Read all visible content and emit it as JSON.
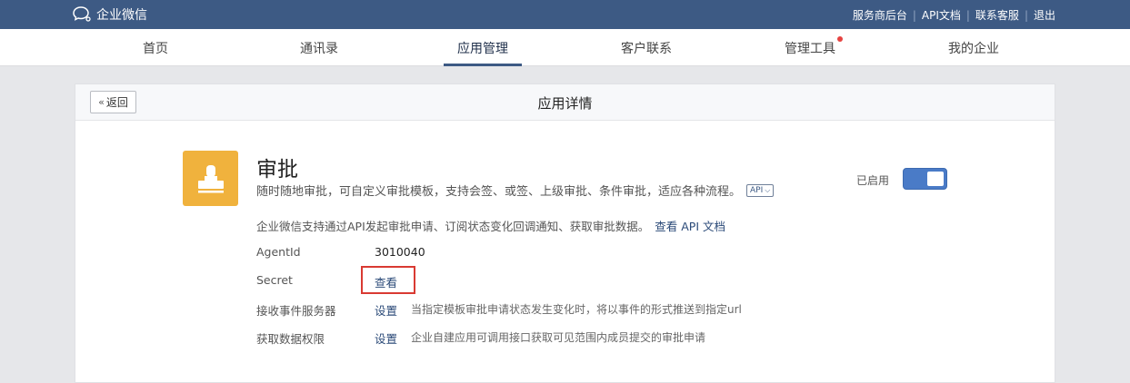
{
  "topbar": {
    "logo_text": "企业微信",
    "links": [
      "服务商后台",
      "API文档",
      "联系客服",
      "退出"
    ]
  },
  "nav": {
    "tabs": [
      "首页",
      "通讯录",
      "应用管理",
      "客户联系",
      "管理工具",
      "我的企业"
    ],
    "active": "应用管理"
  },
  "card": {
    "back_label": "返回",
    "title": "应用详情"
  },
  "app": {
    "name": "审批",
    "description": "随时随地审批，可自定义审批模板，支持会签、或签、上级审批、条件审批，适应各种流程。",
    "api_tag": "API",
    "status_label": "已启用",
    "enabled": true,
    "api_note": "企业微信支持通过API发起审批申请、订阅状态变化回调通知、获取审批数据。",
    "api_link": "查看 API 文档"
  },
  "details": {
    "agentid_label": "AgentId",
    "agentid_value": "3010040",
    "secret_label": "Secret",
    "secret_action": "查看",
    "event_label": "接收事件服务器",
    "event_action": "设置",
    "event_hint": "当指定模板审批申请状态发生变化时，将以事件的形式推送到指定url",
    "data_label": "获取数据权限",
    "data_action": "设置",
    "data_hint": "企业自建应用可调用接口获取可见范围内成员提交的审批申请"
  },
  "colors": {
    "topbar": "#3d5a84",
    "app_icon": "#f0b23d",
    "toggle": "#4a7bc7",
    "highlight": "#d93a32",
    "link": "#2b4a78"
  }
}
